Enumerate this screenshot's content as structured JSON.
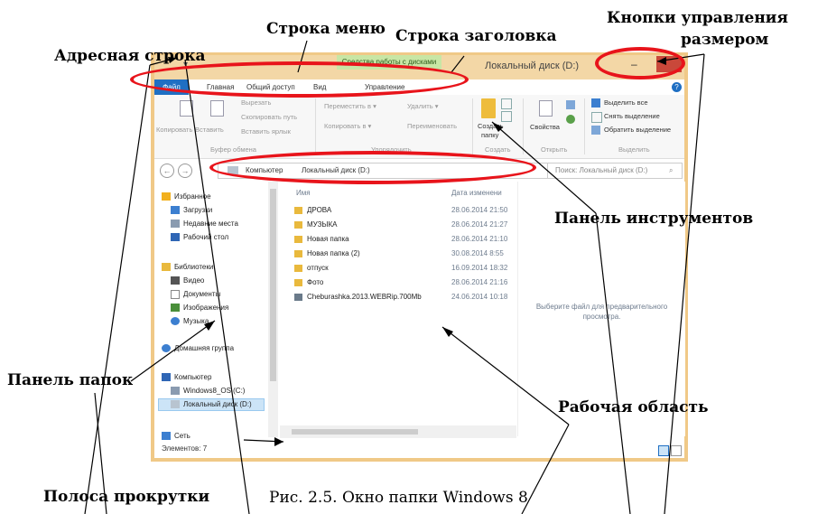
{
  "window": {
    "title": "Локальный диск (D:)",
    "contextual_tab_header": "Средства работы с дисками",
    "minimize_symbol": "–",
    "qat_symbol": "▾",
    "help_symbol": "?"
  },
  "tabs": [
    {
      "label": "Файл"
    },
    {
      "label": "Главная"
    },
    {
      "label": "Общий доступ"
    },
    {
      "label": "Вид"
    },
    {
      "label": "Управление"
    }
  ],
  "ribbon": {
    "copy": "Копировать",
    "paste": "Вставить",
    "cut": "Вырезать",
    "copy_path": "Скопировать путь",
    "paste_shortcut": "Вставить ярлык",
    "move_to": "Переместить в ▾",
    "copy_to": "Копировать в ▾",
    "delete": "Удалить ▾",
    "rename": "Переименовать",
    "new_folder_line1": "Создать",
    "new_folder_line2": "папку",
    "properties": "Свойства",
    "select_all": "Выделить все",
    "select_none": "Снять выделение",
    "invert_selection": "Обратить выделение",
    "group_clipboard": "Буфер обмена",
    "group_organize": "Упорядочить",
    "group_new": "Создать",
    "group_open": "Открыть",
    "group_select": "Выделить"
  },
  "address": {
    "back": "←",
    "forward": "→",
    "crumb1": "Компьютер",
    "crumb2": "Локальный диск (D:)",
    "search_placeholder": "Поиск: Локальный диск (D:)",
    "search_icon": "⌕"
  },
  "nav_pane": {
    "favorites": "Избранное",
    "downloads": "Загрузки",
    "recent": "Недавние места",
    "desktop": "Рабочий стол",
    "libraries": "Библиотеки",
    "video": "Видео",
    "documents": "Документы",
    "images": "Изображения",
    "music": "Музыка",
    "homegroup": "Домашняя группа",
    "computer": "Компьютер",
    "drive_c": "Windows8_OS (C:)",
    "drive_d": "Локальный диск (D:)",
    "network": "Сеть"
  },
  "columns": {
    "name": "Имя",
    "date": "Дата изменени"
  },
  "files": [
    {
      "name": "ДРОВА",
      "date": "28.06.2014 21:50"
    },
    {
      "name": "МУЗЫКА",
      "date": "28.06.2014 21:27"
    },
    {
      "name": "Новая папка",
      "date": "28.06.2014 21:10"
    },
    {
      "name": "Новая папка (2)",
      "date": "30.08.2014 8:55"
    },
    {
      "name": "отпуск",
      "date": "16.09.2014 18:32"
    },
    {
      "name": "Фото",
      "date": "28.06.2014 21:16"
    },
    {
      "name": "Cheburashka.2013.WEBRip.700Mb",
      "date": "24.06.2014 10:18"
    }
  ],
  "preview_text": "Выберите файл для предварительного просмотра.",
  "status": "Элементов: 7",
  "annotations": {
    "address_bar": "Адресная строка",
    "menu_bar": "Строка меню",
    "title_bar": "Строка заголовка",
    "size_buttons_line1": "Кнопки управления",
    "size_buttons_line2": "размером",
    "toolbar": "Панель инструментов",
    "folder_pane": "Панель папок",
    "work_area": "Рабочая область",
    "scrollbar": "Полоса прокрутки",
    "caption": "Рис. 2.5. Окно папки Windows 8"
  },
  "colors": {
    "accent": "#1f6fc3",
    "ellipse": "#e8141b",
    "frame": "#f0c987"
  }
}
